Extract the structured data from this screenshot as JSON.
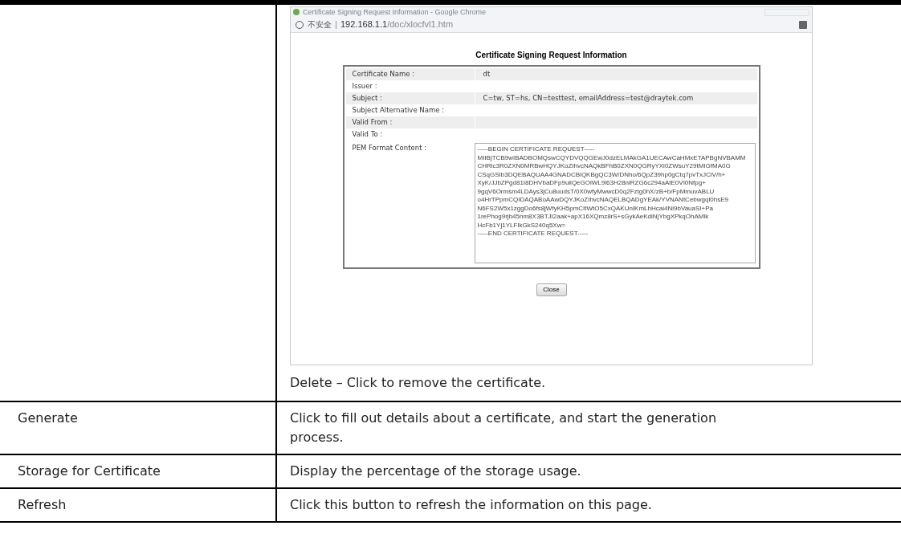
{
  "screenshot_row": {
    "browser": {
      "title": "Certificate Signing Request Information - Google Chrome",
      "security_label": "不安全",
      "url_host": "192.168.1.1",
      "url_path": "/doc/xlocfvl1.htm",
      "heading": "Certificate Signing Request Information",
      "fields": [
        {
          "label": "Certificate Name :",
          "value": "dt"
        },
        {
          "label": "Issuer :"
        },
        {
          "label": "Subject :",
          "value": "C=tw, ST=hs, CN=testtest, emailAddress=test@draytek.com"
        },
        {
          "label": "Subject Alternative Name :"
        },
        {
          "label": "Valid From :"
        },
        {
          "label": "Valid To :"
        }
      ],
      "pem_label": "PEM Format Content :",
      "pem_lines": [
        "-----BEGIN CERTIFICATE REQUEST-----",
        "MIIBjTCB9wIBADBOMQswCQYDVQQGEwJ0dzELMAkGA1UECAwCaHMxETAPBgNVBAMM",
        "CHRlc3R0ZXN0MRBwHQYJKoZIhvcNAQkBFhB0ZXN0QGRyYXl0ZWsuY29tMIGfMA0G",
        "CSqGSIb3DQEBAQUAA4GNADCBiQKBgQC3W/DNho/6QpZ39hp0gCtq7pvTxJCiV/h+",
        "XyK/JJbZPgd81I8DHVbaDFp9uilQeGOlWL9l63H28niRZG6c294aAtE0VI0Nfpg+",
        "9gqV6Ormsm4LDAys3jCu8uudsT/0X0wfyMwwcD0q2Fztg0hX/zB+b/FpMmuvABLU",
        "o4HrTPpmCQIDAQABoAAwDQYJKoZIhvcNAQELBQADgYEAk/YVNANtCebwgql0hsE9",
        "N6FS2W5x1zggDo6fs8jWfyKH5pmCItWtO5CxQAKUnIKmLhHcai4Ni9bVauaSI+Pa",
        "1rePhog9rjb45nm8X3BTJI2aak+apX16XQmz8rS+sGykAeKdiNjYbgXPkqOhAMlk",
        "HcFb1Yj1YLFIkGkS240q5Xw=",
        "-----END CERTIFICATE REQUEST-----"
      ],
      "close_button": "Close"
    },
    "description": "Delete – Click to remove the certificate."
  },
  "rows": [
    {
      "term": "Generate",
      "description": "Click to fill out details about a certificate, and start the generation process."
    },
    {
      "term": "Storage for Certificate",
      "description": "Display the percentage of the storage usage."
    },
    {
      "term": "Refresh",
      "description": "Click this button to refresh the information on this page."
    }
  ]
}
